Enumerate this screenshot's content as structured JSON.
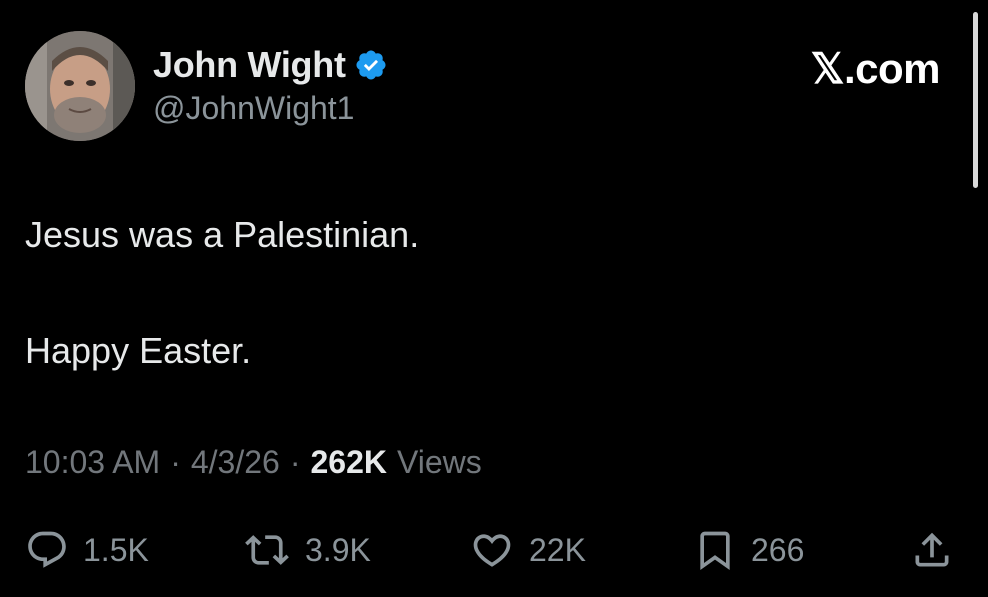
{
  "author": {
    "display_name": "John Wight",
    "handle": "@JohnWight1",
    "verified_color": "#1d9bf0"
  },
  "brand": "𝕏.com",
  "tweet": {
    "line1": "Jesus was a Palestinian.",
    "line2": "Happy Easter."
  },
  "meta": {
    "time": "10:03 AM",
    "date": "4/3/26",
    "views_count": "262K",
    "views_label": "Views",
    "separator": "·"
  },
  "actions": {
    "replies": "1.5K",
    "reposts": "3.9K",
    "likes": "22K",
    "bookmarks": "266"
  },
  "icons": [
    "avatar",
    "verified-badge-icon",
    "reply-icon",
    "repost-icon",
    "like-icon",
    "bookmark-icon",
    "share-icon"
  ]
}
